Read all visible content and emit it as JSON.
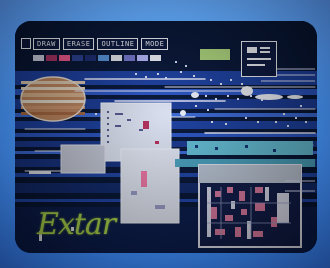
{
  "menu": {
    "items": [
      {
        "label": "DRAW"
      },
      {
        "label": "ERASE"
      },
      {
        "label": "OUTLINE"
      },
      {
        "label": "MODE"
      }
    ]
  },
  "palette": {
    "colors": [
      "#d8d8e8",
      "#b03060",
      "#ff5a8a",
      "#2a3f8f",
      "#1a2a6e",
      "#5a9ae0",
      "#f0f0f0",
      "#7a7ad0",
      "#c0c0ff",
      "#ffffff"
    ]
  },
  "canvas": {
    "script_text": "Extar"
  },
  "colors": {
    "bezel": "#3c7fd0",
    "screen": "#06122e",
    "script": "#b6df4a",
    "band": "#1c3f9e"
  }
}
